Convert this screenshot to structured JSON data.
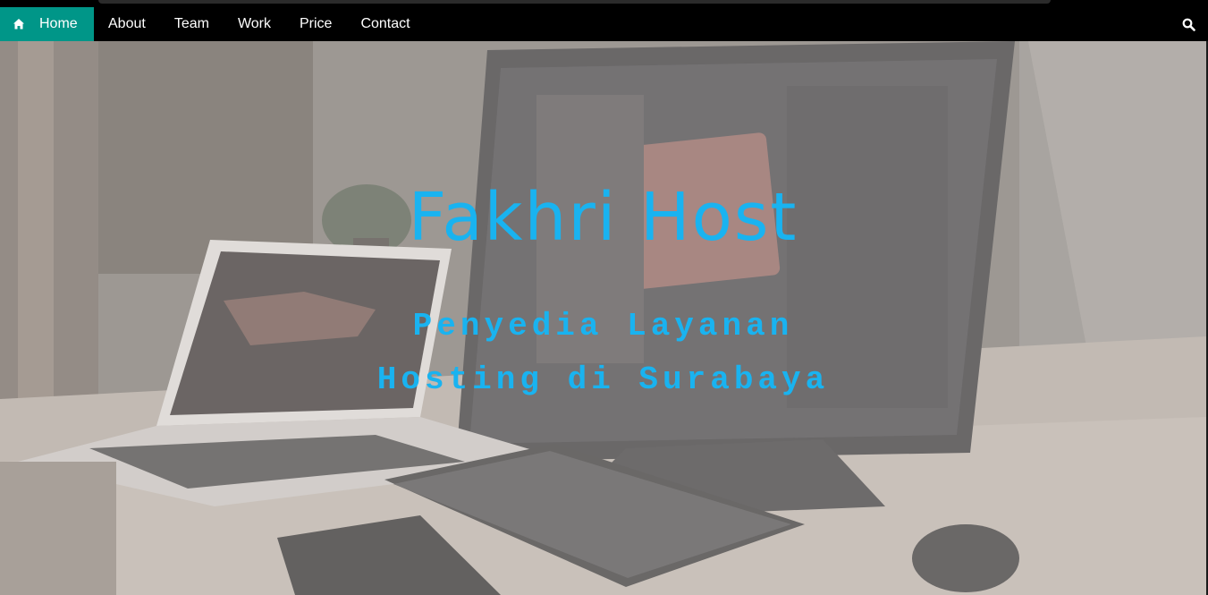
{
  "navbar": {
    "items": [
      {
        "label": "Home",
        "icon": "home-icon",
        "active": true
      },
      {
        "label": "About"
      },
      {
        "label": "Team"
      },
      {
        "label": "Work"
      },
      {
        "label": "Price"
      },
      {
        "label": "Contact"
      }
    ],
    "search_icon": "search-icon"
  },
  "hero": {
    "title": "Fakhri Host",
    "subtitle_line1": "Penyedia Layanan",
    "subtitle_line2": "Hosting di Surabaya"
  },
  "colors": {
    "nav_bg": "#000000",
    "nav_active": "#009688",
    "hero_text": "#19b3f0"
  }
}
